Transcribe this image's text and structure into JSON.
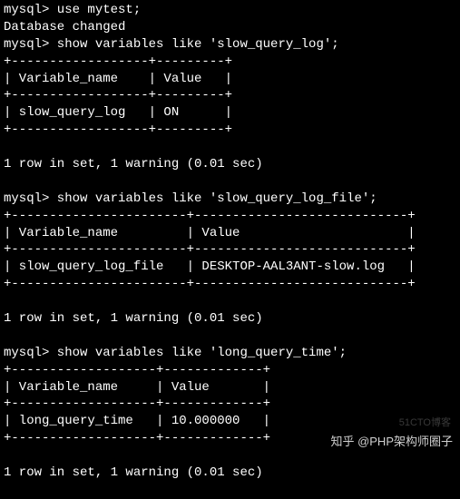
{
  "session": {
    "prompt": "mysql>",
    "db_cmd": "use mytest;",
    "db_resp": "Database changed",
    "queries": [
      {
        "cmd": "show variables like 'slow_query_log';",
        "col1": "Variable_name",
        "col2": "Value",
        "var": "slow_query_log",
        "val": "ON",
        "col1_width": 16,
        "col2_width": 7,
        "status": "1 row in set, 1 warning (0.01 sec)"
      },
      {
        "cmd": "show variables like 'slow_query_log_file';",
        "col1": "Variable_name",
        "col2": "Value",
        "var": "slow_query_log_file",
        "val": "DESKTOP-AAL3ANT-slow.log",
        "col1_width": 21,
        "col2_width": 26,
        "status": "1 row in set, 1 warning (0.01 sec)"
      },
      {
        "cmd": "show variables like 'long_query_time';",
        "col1": "Variable_name",
        "col2": "Value",
        "var": "long_query_time",
        "val": "10.000000",
        "col1_width": 17,
        "col2_width": 11,
        "status": "1 row in set, 1 warning (0.01 sec)"
      }
    ]
  },
  "watermarks": {
    "w1": "51CTO博客",
    "w2": "知乎 @PHP架构师圈子"
  }
}
